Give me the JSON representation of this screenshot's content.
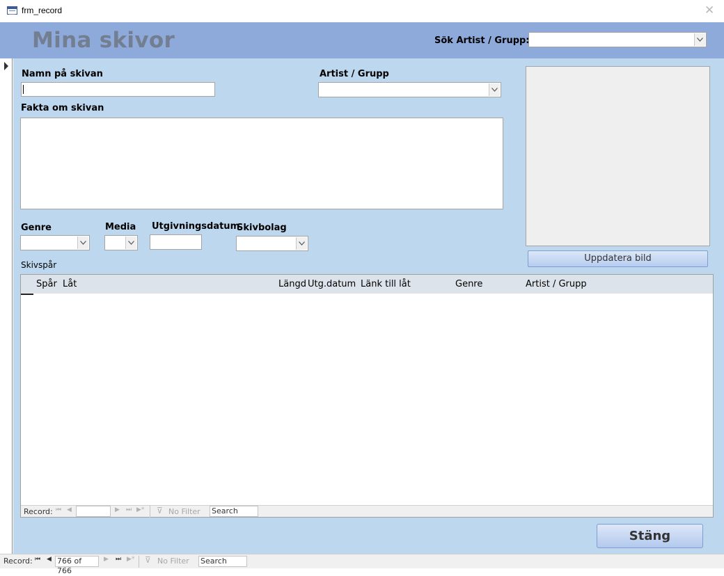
{
  "window": {
    "title": "frm_record",
    "close_glyph": "✕"
  },
  "header": {
    "form_title": "Mina skivor",
    "search_label": "Sök Artist / Grupp:",
    "search_value": ""
  },
  "fields": {
    "album_name_label": "Namn på skivan",
    "album_name_value": "",
    "artist_label": "Artist / Grupp",
    "artist_value": "",
    "facts_label": "Fakta om skivan",
    "facts_value": "",
    "genre_label": "Genre",
    "genre_value": "",
    "media_label": "Media",
    "media_value": "",
    "release_date_label": "Utgivningsdatum",
    "release_date_value": "",
    "label_label": "Skivbolag",
    "label_value": ""
  },
  "picture": {
    "update_button_label": "Uppdatera bild"
  },
  "tracks": {
    "section_label": "Skivspår",
    "columns": [
      "Spår",
      "Låt",
      "Längd",
      "Utg.datum",
      "Länk till låt",
      "Genre",
      "Artist / Grupp"
    ],
    "rows": [],
    "nav": {
      "record_label": "Record:",
      "position": "",
      "filter_label": "No Filter",
      "search_placeholder": "Search"
    }
  },
  "main_nav": {
    "record_label": "Record:",
    "position": "766 of 766",
    "filter_label": "No Filter",
    "search_placeholder": "Search"
  },
  "buttons": {
    "close_label": "Stäng"
  },
  "colors": {
    "header_bg": "#8eaadb",
    "detail_bg": "#bdd7ee",
    "title_fg": "#747e91"
  }
}
